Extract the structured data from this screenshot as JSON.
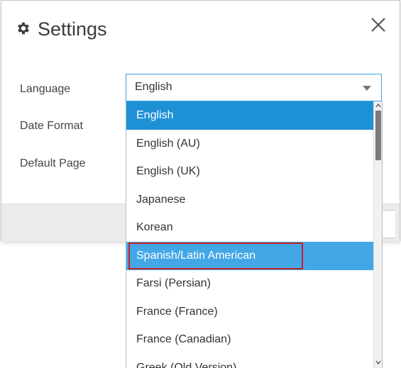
{
  "dialog": {
    "title": "Settings",
    "icons": {
      "settings": "gear-icon",
      "close": "close-icon"
    }
  },
  "form": {
    "language_label": "Language",
    "date_format_label": "Date Format",
    "default_page_label": "Default Page"
  },
  "language_select": {
    "selected": "English",
    "options": [
      "English",
      "English (AU)",
      "English (UK)",
      "Japanese",
      "Korean",
      "Spanish/Latin American",
      "Farsi (Persian)",
      "France (France)",
      "France (Canadian)",
      "Greek (Old Version)"
    ],
    "highlighted_option": "Spanish/Latin American"
  },
  "colors": {
    "accent": "#1e90d6",
    "hover": "#43a7e6",
    "highlight_border": "#c8202a"
  }
}
